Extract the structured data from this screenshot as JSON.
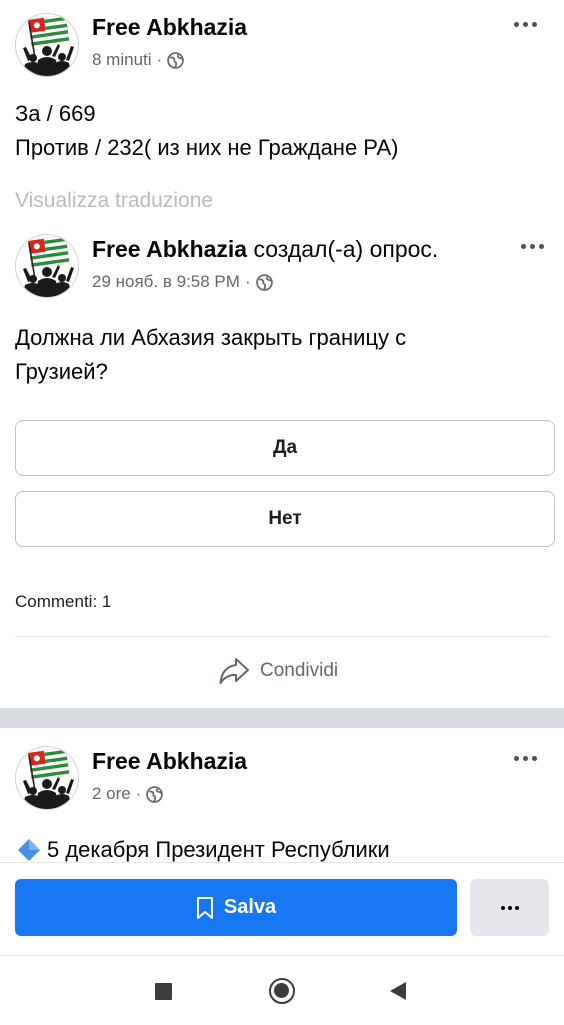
{
  "post1": {
    "page_name": "Free Abkhazia",
    "time": "8 minuti",
    "dot": "·",
    "privacy_icon": "globe-icon",
    "more_icon": "more-horizontal-icon",
    "text_line1": "За / 669",
    "text_line2": "Против / 232( из них не Граждане РА)",
    "see_translation": "Visualizza traduzione"
  },
  "shared": {
    "page_name": "Free Abkhazia",
    "action": " создал(-а) опрос.",
    "time": "29 нояб. в 9:58 PM",
    "dot": "·",
    "privacy_icon": "globe-icon",
    "more_icon": "more-horizontal-icon",
    "question_line1": "Должна ли Абхазия закрыть границу с",
    "question_line2": "Грузией?",
    "options": [
      "Да",
      "Нет"
    ]
  },
  "footer": {
    "comments": "Commenti: 1",
    "share_label": "Condividi",
    "share_icon": "share-arrow-icon"
  },
  "post2": {
    "page_name": "Free Abkhazia",
    "time": "2 ore",
    "dot": "·",
    "privacy_icon": "globe-icon",
    "more_icon": "more-horizontal-icon",
    "text_line1": "5 декабря Президент Республики",
    "bullet_icon": "blue-diamond-icon"
  },
  "bottom": {
    "save_label": "Salva",
    "save_icon": "bookmark-icon",
    "more_icon": "more-horizontal-icon"
  },
  "android_nav": {
    "recents_icon": "square-recents-icon",
    "home_icon": "circle-home-icon",
    "back_icon": "triangle-back-icon"
  },
  "colors": {
    "accent": "#1877f2",
    "secondary_text": "#65676b",
    "translation_text": "#b8bcc2",
    "separator": "#dadde1",
    "flag_green": "#2e8b3a",
    "flag_red": "#d7261e"
  }
}
